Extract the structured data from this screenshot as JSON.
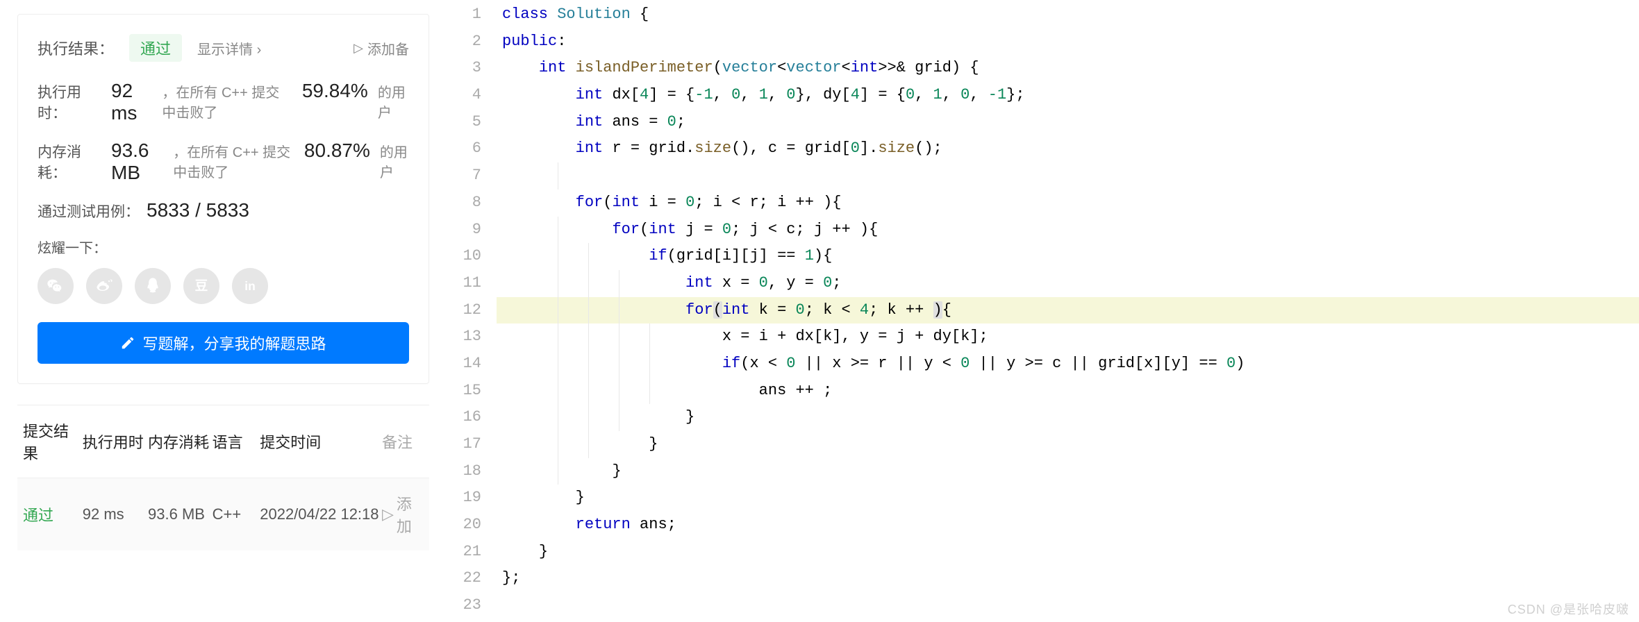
{
  "result": {
    "label": "执行结果：",
    "status": "通过",
    "details_link": "显示详情",
    "add_note": "添加备"
  },
  "stats": {
    "time_label": "执行用时：",
    "time_value": "92 ms",
    "time_desc_prefix": "，在所有 C++ 提交中击败了",
    "time_pct": "59.84%",
    "time_desc_suffix": "的用户",
    "mem_label": "内存消耗：",
    "mem_value": "93.6 MB",
    "mem_desc_prefix": "，在所有 C++ 提交中击败了",
    "mem_pct": "80.87%",
    "mem_desc_suffix": "的用户",
    "cases_label": "通过测试用例：",
    "cases_value": "5833 / 5833"
  },
  "boast": {
    "label": "炫耀一下："
  },
  "write_button": "写题解，分享我的解题思路",
  "table": {
    "headers": {
      "result": "提交结果",
      "time": "执行用时",
      "mem": "内存消耗",
      "lang": "语言",
      "date": "提交时间",
      "note": "备注"
    },
    "row": {
      "result": "通过",
      "time": "92 ms",
      "mem": "93.6 MB",
      "lang": "C++",
      "date": "2022/04/22 12:18",
      "note": "添加"
    }
  },
  "code": {
    "lines": [
      {
        "n": 1,
        "tokens": [
          {
            "t": "class ",
            "c": "kw"
          },
          {
            "t": "Solution",
            "c": "type"
          },
          {
            "t": " {",
            "c": "op"
          }
        ]
      },
      {
        "n": 2,
        "tokens": [
          {
            "t": "public",
            "c": "kw"
          },
          {
            "t": ":",
            "c": "op"
          }
        ]
      },
      {
        "n": 3,
        "indent": 1,
        "tokens": [
          {
            "t": "int ",
            "c": "kw"
          },
          {
            "t": "islandPerimeter",
            "c": "fn"
          },
          {
            "t": "(",
            "c": "op"
          },
          {
            "t": "vector",
            "c": "type"
          },
          {
            "t": "<",
            "c": "op"
          },
          {
            "t": "vector",
            "c": "type"
          },
          {
            "t": "<",
            "c": "op"
          },
          {
            "t": "int",
            "c": "kw"
          },
          {
            "t": ">>& grid) {",
            "c": "op"
          }
        ]
      },
      {
        "n": 4,
        "indent": 2,
        "tokens": [
          {
            "t": "int ",
            "c": "kw"
          },
          {
            "t": "dx[",
            "c": "ident"
          },
          {
            "t": "4",
            "c": "num"
          },
          {
            "t": "] = {",
            "c": "op"
          },
          {
            "t": "-1",
            "c": "num"
          },
          {
            "t": ", ",
            "c": "op"
          },
          {
            "t": "0",
            "c": "num"
          },
          {
            "t": ", ",
            "c": "op"
          },
          {
            "t": "1",
            "c": "num"
          },
          {
            "t": ", ",
            "c": "op"
          },
          {
            "t": "0",
            "c": "num"
          },
          {
            "t": "}, dy[",
            "c": "op"
          },
          {
            "t": "4",
            "c": "num"
          },
          {
            "t": "] = {",
            "c": "op"
          },
          {
            "t": "0",
            "c": "num"
          },
          {
            "t": ", ",
            "c": "op"
          },
          {
            "t": "1",
            "c": "num"
          },
          {
            "t": ", ",
            "c": "op"
          },
          {
            "t": "0",
            "c": "num"
          },
          {
            "t": ", ",
            "c": "op"
          },
          {
            "t": "-1",
            "c": "num"
          },
          {
            "t": "};",
            "c": "op"
          }
        ]
      },
      {
        "n": 5,
        "indent": 2,
        "tokens": [
          {
            "t": "int ",
            "c": "kw"
          },
          {
            "t": "ans = ",
            "c": "ident"
          },
          {
            "t": "0",
            "c": "num"
          },
          {
            "t": ";",
            "c": "op"
          }
        ]
      },
      {
        "n": 6,
        "indent": 2,
        "tokens": [
          {
            "t": "int ",
            "c": "kw"
          },
          {
            "t": "r = grid.",
            "c": "ident"
          },
          {
            "t": "size",
            "c": "fn"
          },
          {
            "t": "(), c = grid[",
            "c": "op"
          },
          {
            "t": "0",
            "c": "num"
          },
          {
            "t": "].",
            "c": "op"
          },
          {
            "t": "size",
            "c": "fn"
          },
          {
            "t": "();",
            "c": "op"
          }
        ]
      },
      {
        "n": 7,
        "indent": 2,
        "guides": [
          0
        ],
        "tokens": []
      },
      {
        "n": 8,
        "indent": 2,
        "tokens": [
          {
            "t": "for",
            "c": "kw"
          },
          {
            "t": "(",
            "c": "op"
          },
          {
            "t": "int ",
            "c": "kw"
          },
          {
            "t": "i = ",
            "c": "ident"
          },
          {
            "t": "0",
            "c": "num"
          },
          {
            "t": "; i < r; i ++ ){",
            "c": "op"
          }
        ]
      },
      {
        "n": 9,
        "indent": 3,
        "guides": [
          0
        ],
        "tokens": [
          {
            "t": "for",
            "c": "kw"
          },
          {
            "t": "(",
            "c": "op"
          },
          {
            "t": "int ",
            "c": "kw"
          },
          {
            "t": "j = ",
            "c": "ident"
          },
          {
            "t": "0",
            "c": "num"
          },
          {
            "t": "; j < c; j ++ ){",
            "c": "op"
          }
        ]
      },
      {
        "n": 10,
        "indent": 4,
        "guides": [
          0,
          1
        ],
        "tokens": [
          {
            "t": "if",
            "c": "kw"
          },
          {
            "t": "(grid[i][j] == ",
            "c": "op"
          },
          {
            "t": "1",
            "c": "num"
          },
          {
            "t": "){",
            "c": "op"
          }
        ]
      },
      {
        "n": 11,
        "indent": 5,
        "guides": [
          0,
          1,
          2
        ],
        "tokens": [
          {
            "t": "int ",
            "c": "kw"
          },
          {
            "t": "x = ",
            "c": "ident"
          },
          {
            "t": "0",
            "c": "num"
          },
          {
            "t": ", y = ",
            "c": "op"
          },
          {
            "t": "0",
            "c": "num"
          },
          {
            "t": ";",
            "c": "op"
          }
        ]
      },
      {
        "n": 12,
        "indent": 5,
        "guides": [
          0,
          1,
          2
        ],
        "hl": true,
        "tokens": [
          {
            "t": "for",
            "c": "kw"
          },
          {
            "t": "(",
            "c": "op paren-hl"
          },
          {
            "t": "int ",
            "c": "kw"
          },
          {
            "t": "k = ",
            "c": "ident"
          },
          {
            "t": "0",
            "c": "num"
          },
          {
            "t": "; k < ",
            "c": "op"
          },
          {
            "t": "4",
            "c": "num"
          },
          {
            "t": "; k ++ ",
            "c": "op"
          },
          {
            "t": ")",
            "c": "op paren-hl"
          },
          {
            "t": "{",
            "c": "op"
          }
        ]
      },
      {
        "n": 13,
        "indent": 6,
        "guides": [
          0,
          1,
          2,
          3
        ],
        "tokens": [
          {
            "t": "x = i + dx[k], y = j + dy[k];",
            "c": "ident"
          }
        ]
      },
      {
        "n": 14,
        "indent": 6,
        "guides": [
          0,
          1,
          2,
          3
        ],
        "tokens": [
          {
            "t": "if",
            "c": "kw"
          },
          {
            "t": "(x < ",
            "c": "op"
          },
          {
            "t": "0",
            "c": "num"
          },
          {
            "t": " || x >= r || y < ",
            "c": "op"
          },
          {
            "t": "0",
            "c": "num"
          },
          {
            "t": " || y >= c || grid[x][y] == ",
            "c": "op"
          },
          {
            "t": "0",
            "c": "num"
          },
          {
            "t": ")",
            "c": "op"
          }
        ]
      },
      {
        "n": 15,
        "indent": 7,
        "guides": [
          0,
          1,
          2,
          3
        ],
        "tokens": [
          {
            "t": "ans ++ ;",
            "c": "ident"
          }
        ]
      },
      {
        "n": 16,
        "indent": 5,
        "guides": [
          0,
          1,
          2
        ],
        "tokens": [
          {
            "t": "}",
            "c": "op"
          }
        ]
      },
      {
        "n": 17,
        "indent": 4,
        "guides": [
          0,
          1
        ],
        "tokens": [
          {
            "t": "}",
            "c": "op"
          }
        ]
      },
      {
        "n": 18,
        "indent": 3,
        "guides": [
          0
        ],
        "tokens": [
          {
            "t": "}",
            "c": "op"
          }
        ]
      },
      {
        "n": 19,
        "indent": 2,
        "tokens": [
          {
            "t": "}",
            "c": "op"
          }
        ]
      },
      {
        "n": 20,
        "indent": 2,
        "tokens": [
          {
            "t": "return ",
            "c": "kw"
          },
          {
            "t": "ans;",
            "c": "ident"
          }
        ]
      },
      {
        "n": 21,
        "indent": 1,
        "tokens": [
          {
            "t": "}",
            "c": "op"
          }
        ]
      },
      {
        "n": 22,
        "indent": 0,
        "tokens": [
          {
            "t": "};",
            "c": "op"
          }
        ]
      },
      {
        "n": 23,
        "indent": 0,
        "tokens": []
      }
    ]
  },
  "watermark": "CSDN @是张哈皮啵"
}
